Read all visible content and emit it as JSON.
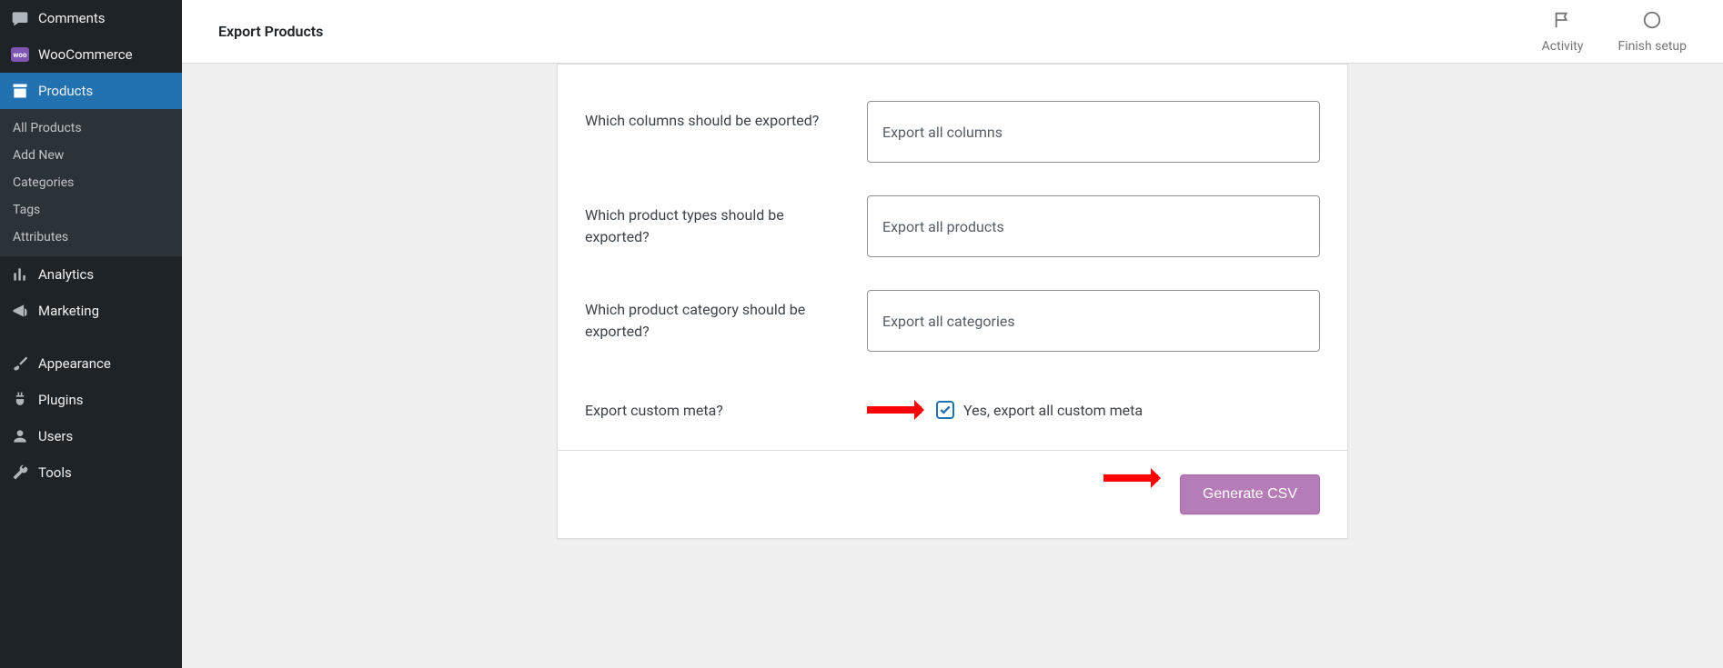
{
  "sidebar": {
    "comments": "Comments",
    "woocommerce": "WooCommerce",
    "products": "Products",
    "submenu": {
      "all_products": "All Products",
      "add_new": "Add New",
      "categories": "Categories",
      "tags": "Tags",
      "attributes": "Attributes"
    },
    "analytics": "Analytics",
    "marketing": "Marketing",
    "appearance": "Appearance",
    "plugins": "Plugins",
    "users": "Users",
    "tools": "Tools"
  },
  "topbar": {
    "title": "Export Products",
    "activity": "Activity",
    "finish_setup": "Finish setup"
  },
  "form": {
    "columns_label": "Which columns should be exported?",
    "columns_placeholder": "Export all columns",
    "types_label": "Which product types should be exported?",
    "types_placeholder": "Export all products",
    "category_label": "Which product category should be exported?",
    "category_placeholder": "Export all categories",
    "meta_label": "Export custom meta?",
    "meta_checkbox_label": "Yes, export all custom meta",
    "meta_checked": true,
    "submit_label": "Generate CSV"
  }
}
